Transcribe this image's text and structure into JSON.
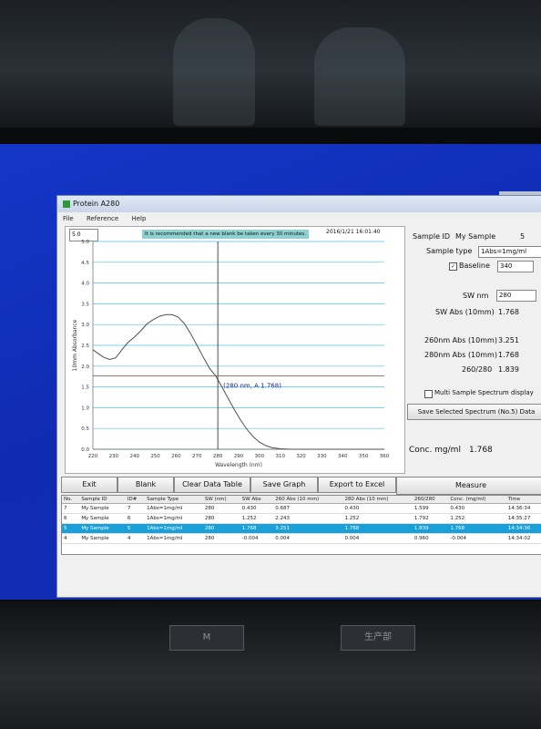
{
  "window": {
    "title": "Protein A280",
    "menu": [
      "File",
      "Reference",
      "Help"
    ]
  },
  "graph": {
    "scale_value": "5.0",
    "recommendation": "It is recommended that a new blank be taken every 30 minutes.",
    "datetime": "2016/1/21 16:01:40",
    "crosshair_label": "(280 nm, A 1.768)"
  },
  "chart_data": {
    "type": "line",
    "xlabel": "Wavelength (nm)",
    "ylabel": "10mm Absorbance",
    "xlim": [
      220,
      360
    ],
    "ylim": [
      0,
      5.0
    ],
    "x_ticks": [
      220,
      230,
      240,
      250,
      260,
      270,
      280,
      290,
      300,
      310,
      320,
      330,
      340,
      350,
      360
    ],
    "y_ticks": [
      0.0,
      0.5,
      1.0,
      1.5,
      2.0,
      2.5,
      3.0,
      3.5,
      4.0,
      4.5,
      5.0
    ],
    "grid": true,
    "crosshair": {
      "x": 280,
      "y": 1.768
    },
    "series": [
      {
        "x": [
          220,
          222,
          225,
          228,
          231,
          234,
          237,
          240,
          243,
          246,
          249,
          252,
          255,
          258,
          261,
          264,
          267,
          270,
          273,
          276,
          279,
          282,
          285,
          288,
          291,
          294,
          297,
          300,
          303,
          306,
          310,
          315,
          320,
          330,
          340,
          350,
          360
        ],
        "y": [
          2.4,
          2.32,
          2.22,
          2.16,
          2.2,
          2.4,
          2.58,
          2.7,
          2.85,
          3.02,
          3.12,
          3.2,
          3.24,
          3.24,
          3.18,
          3.02,
          2.78,
          2.5,
          2.22,
          1.95,
          1.76,
          1.5,
          1.22,
          0.95,
          0.7,
          0.48,
          0.3,
          0.17,
          0.09,
          0.04,
          0.01,
          0.0,
          0.0,
          0.0,
          0.0,
          0.0,
          0.0
        ]
      }
    ]
  },
  "panel": {
    "sample_id_label": "Sample ID",
    "sample_id_value": "My Sample",
    "sample_no": "5",
    "sample_type_label": "Sample type",
    "sample_type_value": "1Abs=1mg/ml",
    "baseline_label": "Baseline",
    "baseline_check": "✓",
    "baseline_value": "340",
    "sw_nm_label": "SW nm",
    "sw_nm_value": "280",
    "sw_abs_label": "SW Abs (10mm)",
    "sw_abs_value": "1.768",
    "abs260_label": "260nm Abs (10mm)",
    "abs260_value": "3.251",
    "abs280_label": "280nm Abs (10mm)",
    "abs280_value": "1.768",
    "ratio_label": "260/280",
    "ratio_value": "1.839",
    "multi_sample_label": "Multi Sample Spectrum display",
    "save_selected_label": "Save Selected Spectrum (No.5) Data",
    "conc_label": "Conc. mg/ml",
    "conc_value": "1.768"
  },
  "buttons": {
    "exit": "Exit",
    "blank": "Blank",
    "clear": "Clear Data Table",
    "save_graph": "Save Graph",
    "export": "Export to Excel",
    "measure": "Measure"
  },
  "table": {
    "columns": [
      "No.",
      "Sample ID",
      "ID#",
      "Sample Type",
      "SW (nm)",
      "SW Abs",
      "260 Abs (10 mm)",
      "280 Abs (10 mm)",
      "260/280",
      "Conc. (mg/ml)",
      "Time"
    ],
    "rows": [
      [
        "7",
        "My Sample",
        "7",
        "1Abs=1mg/ml",
        "280",
        "0.430",
        "0.687",
        "0.430",
        "1.599",
        "0.430",
        "14:36:34"
      ],
      [
        "6",
        "My Sample",
        "6",
        "1Abs=1mg/ml",
        "280",
        "1.252",
        "2.243",
        "1.252",
        "1.792",
        "1.252",
        "14:35:27"
      ],
      [
        "5",
        "My Sample",
        "5",
        "1Abs=1mg/ml",
        "280",
        "1.768",
        "3.251",
        "1.768",
        "1.839",
        "1.768",
        "14:34:36"
      ],
      [
        "4",
        "My Sample",
        "4",
        "1Abs=1mg/ml",
        "280",
        "-0.004",
        "0.004",
        "0.004",
        "0.960",
        "-0.004",
        "14:34:02"
      ]
    ],
    "selected_row": 2
  },
  "environment": {
    "badge_left": "M",
    "badge_right": "生产部"
  }
}
